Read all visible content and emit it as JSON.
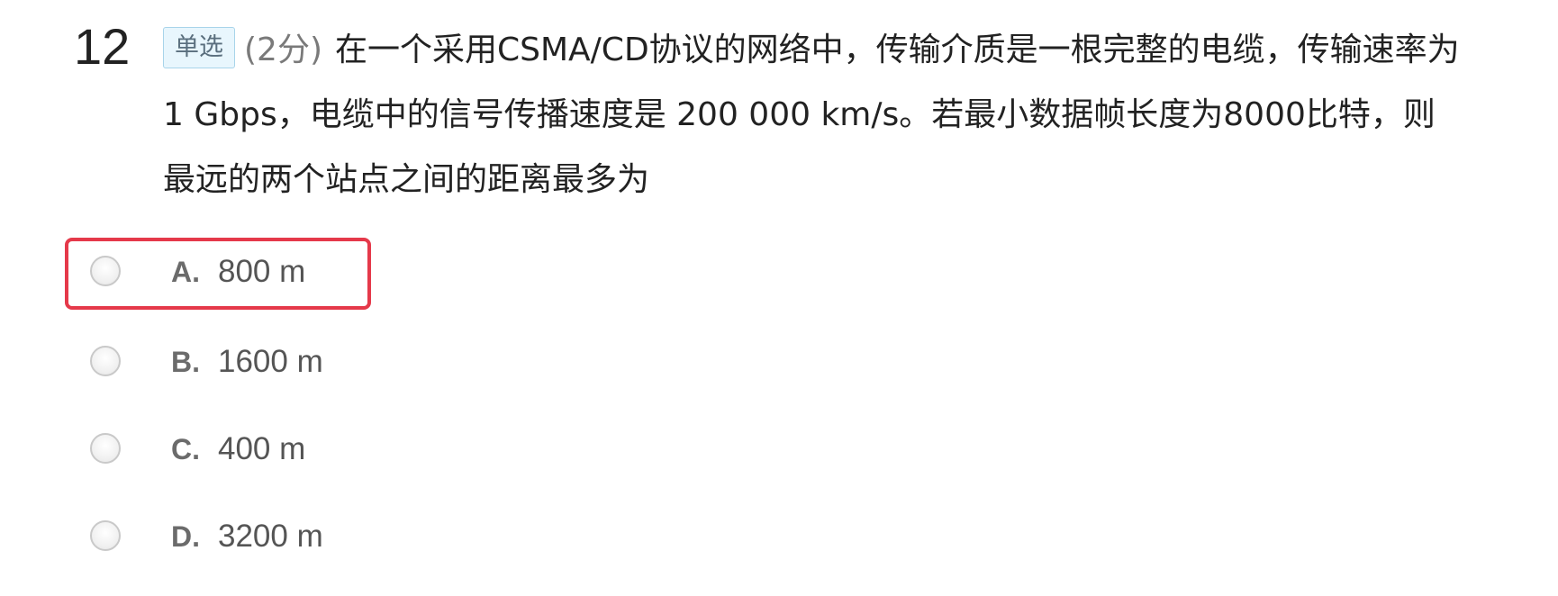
{
  "question": {
    "number": "12",
    "type_tag": "单选",
    "score": "(2分)",
    "text": "在一个采用CSMA/CD协议的网络中，传输介质是一根完整的电缆，传输速率为1 Gbps，电缆中的信号传播速度是 200 000 km/s。若最小数据帧长度为8000比特，则最远的两个站点之间的距离最多为"
  },
  "options": [
    {
      "letter": "A.",
      "text": "800 m",
      "highlighted": true
    },
    {
      "letter": "B.",
      "text": "1600 m",
      "highlighted": false
    },
    {
      "letter": "C.",
      "text": "400 m",
      "highlighted": false
    },
    {
      "letter": "D.",
      "text": "3200 m",
      "highlighted": false
    }
  ],
  "colors": {
    "highlight_border": "#e5394a",
    "tag_background": "#e8f6fd",
    "tag_border": "#a8d4ea"
  }
}
